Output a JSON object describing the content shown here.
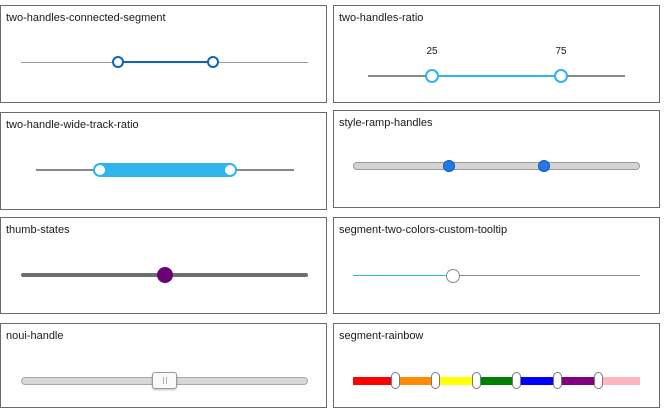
{
  "cards": {
    "two_handles_connected_segment": {
      "title": "two-handles-connected-segment",
      "values": [
        0.33,
        0.67
      ]
    },
    "two_handles_ratio": {
      "title": "two-handles-ratio",
      "labels": [
        "25",
        "75"
      ],
      "values": [
        0.25,
        0.75
      ]
    },
    "two_handle_wide_track_ratio": {
      "title": "two-handle-wide-track-ratio",
      "values": [
        0.25,
        0.75
      ]
    },
    "style_ramp_handles": {
      "title": "style-ramp-handles",
      "values": [
        0.33,
        0.67
      ]
    },
    "thumb_states": {
      "title": "thumb-states",
      "values": [
        0.5
      ]
    },
    "segment_two_colors_custom_tooltip": {
      "title": "segment-two-colors-custom-tooltip",
      "values": [
        0.35
      ]
    },
    "noui_handle": {
      "title": "noui-handle",
      "values": [
        0.5
      ]
    },
    "segment_rainbow": {
      "title": "segment-rainbow",
      "segment_colors": [
        "#ff0000",
        "#ff8c00",
        "#ffff00",
        "#008000",
        "#0000ff",
        "#800080",
        "#ffb6c1"
      ]
    }
  },
  "colors": {
    "dark_blue": "#0d63b8",
    "light_blue": "#2fb5ea",
    "ramp_blue": "#1e7be8",
    "purple": "#6a0073",
    "gray_track": "#9b9b9b"
  }
}
